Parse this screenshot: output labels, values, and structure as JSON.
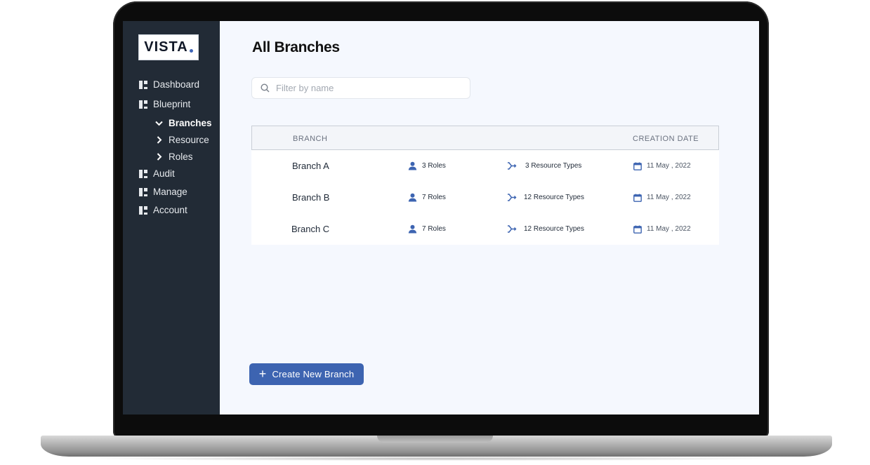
{
  "app": {
    "logo_text": "VISTA",
    "accent": "#3d64b1"
  },
  "sidebar": {
    "items": [
      {
        "label": "Dashboard",
        "icon": "grid-icon"
      },
      {
        "label": "Blueprint",
        "icon": "grid-icon"
      },
      {
        "label": "Audit",
        "icon": "grid-icon"
      },
      {
        "label": "Manage",
        "icon": "grid-icon"
      },
      {
        "label": "Account",
        "icon": "grid-icon"
      }
    ],
    "sub_items": [
      {
        "label": "Branches",
        "icon": "chevron-down-icon",
        "active": true
      },
      {
        "label": "Resource",
        "icon": "chevron-right-icon",
        "active": false
      },
      {
        "label": "Roles",
        "icon": "chevron-right-icon",
        "active": false
      }
    ]
  },
  "main": {
    "title": "All Branches",
    "search": {
      "placeholder": "Filter by name",
      "value": ""
    },
    "table": {
      "headers": {
        "branch": "BRANCH",
        "creation_date": "CREATION DATE"
      },
      "rows": [
        {
          "name": "Branch A",
          "roles": "3 Roles",
          "resources": "3 Resource Types",
          "date": "11 May , 2022"
        },
        {
          "name": "Branch B",
          "roles": "7 Roles",
          "resources": "12 Resource Types",
          "date": "11 May , 2022"
        },
        {
          "name": "Branch C",
          "roles": "7 Roles",
          "resources": "12 Resource Types",
          "date": "11 May , 2022"
        }
      ]
    },
    "create_button": {
      "label": "Create New Branch",
      "icon": "plus-icon"
    }
  }
}
